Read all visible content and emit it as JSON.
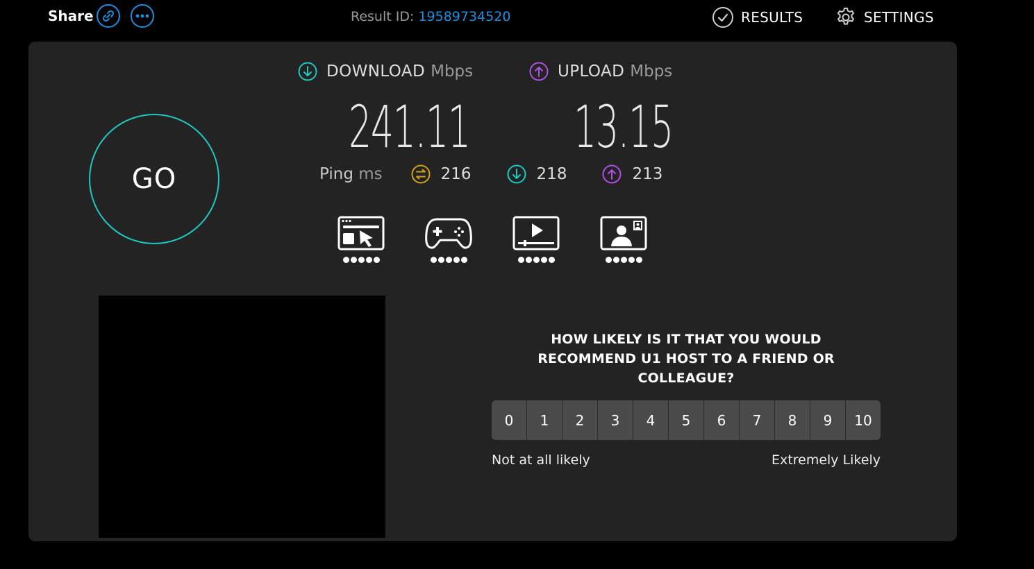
{
  "header": {
    "share_label": "Share",
    "result_id_label": "Result ID:",
    "result_id_value": "19589734520",
    "results_label": "RESULTS",
    "settings_label": "SETTINGS"
  },
  "go_label": "GO",
  "download": {
    "label": "DOWNLOAD",
    "unit": "Mbps",
    "value": "241.11"
  },
  "upload": {
    "label": "UPLOAD",
    "unit": "Mbps",
    "value": "13.15"
  },
  "ping": {
    "label": "Ping",
    "unit": "ms",
    "idle": "216",
    "download": "218",
    "upload": "213"
  },
  "activities": [
    {
      "icon": "web-browsing-icon",
      "rating": 5
    },
    {
      "icon": "gaming-icon",
      "rating": 5
    },
    {
      "icon": "video-streaming-icon",
      "rating": 5
    },
    {
      "icon": "video-chat-icon",
      "rating": 5
    }
  ],
  "survey": {
    "question": "HOW LIKELY IS IT THAT YOU WOULD RECOMMEND U1 HOST TO A FRIEND OR COLLEAGUE?",
    "scale": [
      "0",
      "1",
      "2",
      "3",
      "4",
      "5",
      "6",
      "7",
      "8",
      "9",
      "10"
    ],
    "low_label": "Not at all likely",
    "high_label": "Extremely Likely"
  },
  "colors": {
    "accent_blue": "#1c8fe0",
    "download_teal": "#1ec9c2",
    "upload_purple": "#b14fe8",
    "ping_gold": "#d4a017"
  }
}
